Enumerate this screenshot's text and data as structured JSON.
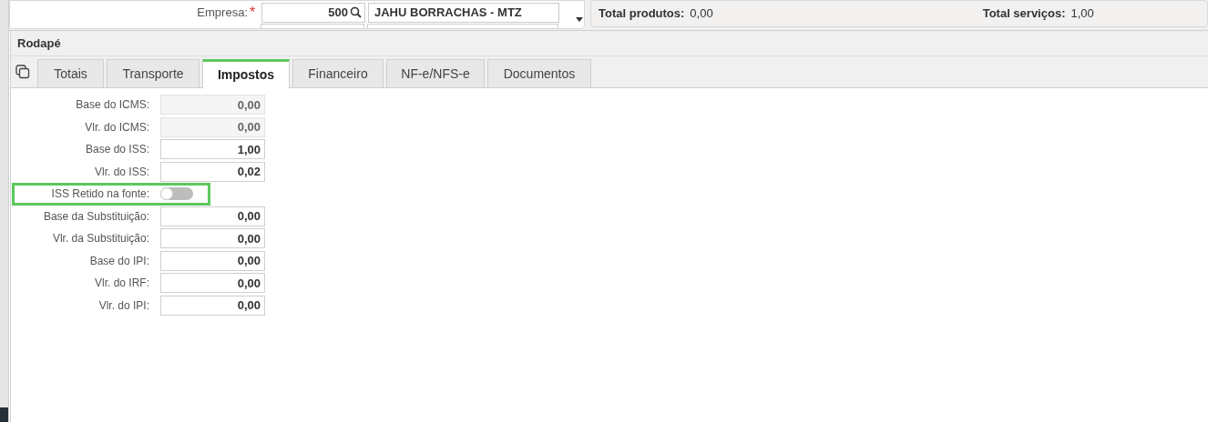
{
  "header": {
    "company_label": "Empresa:",
    "required_mark": "*",
    "company_code": "500",
    "company_name": "JAHU BORRACHAS - MTZ"
  },
  "totals": [
    {
      "label": "Total produtos:",
      "value": "0,00"
    },
    {
      "label": "Total serviços:",
      "value": "1,00"
    }
  ],
  "section": {
    "title": "Rodapé"
  },
  "tabs": [
    {
      "label": "Totais",
      "selected": false
    },
    {
      "label": "Transporte",
      "selected": false
    },
    {
      "label": "Impostos",
      "selected": true
    },
    {
      "label": "Financeiro",
      "selected": false
    },
    {
      "label": "NF-e/NFS-e",
      "selected": false
    },
    {
      "label": "Documentos",
      "selected": false
    }
  ],
  "fields": [
    {
      "kind": "number",
      "label": "Base do ICMS:",
      "value": "0,00",
      "disabled": true
    },
    {
      "kind": "number",
      "label": "Vlr. do ICMS:",
      "value": "0,00",
      "disabled": true
    },
    {
      "kind": "number",
      "label": "Base do ISS:",
      "value": "1,00",
      "disabled": false
    },
    {
      "kind": "number",
      "label": "Vlr. do ISS:",
      "value": "0,02",
      "disabled": false
    },
    {
      "kind": "toggle",
      "label": "ISS Retido na fonte:",
      "on": false,
      "highlighted": true
    },
    {
      "kind": "number",
      "label": "Base da Substituição:",
      "value": "0,00",
      "disabled": false
    },
    {
      "kind": "number",
      "label": "Vlr. da Substituição:",
      "value": "0,00",
      "disabled": false
    },
    {
      "kind": "number",
      "label": "Base do IPI:",
      "value": "0,00",
      "disabled": false
    },
    {
      "kind": "number",
      "label": "Vlr. do IRF:",
      "value": "0,00",
      "disabled": false
    },
    {
      "kind": "number",
      "label": "Vlr. do IPI:",
      "value": "0,00",
      "disabled": false
    }
  ]
}
